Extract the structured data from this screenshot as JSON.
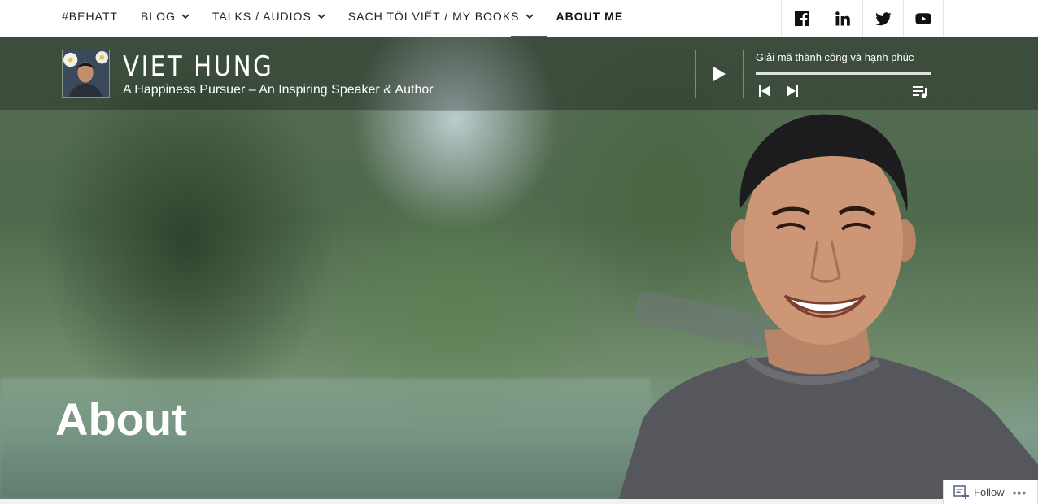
{
  "nav": {
    "items": [
      {
        "label": "#BEHATT",
        "dropdown": false
      },
      {
        "label": "BLOG",
        "dropdown": true
      },
      {
        "label": "TALKS / AUDIOS",
        "dropdown": true
      },
      {
        "label": "SÁCH TÔI VIẾT / MY BOOKS",
        "dropdown": true
      },
      {
        "label": "ABOUT ME",
        "dropdown": false,
        "active": true
      }
    ]
  },
  "social": [
    "facebook-icon",
    "linkedin-icon",
    "twitter-icon",
    "youtube-icon"
  ],
  "site": {
    "title": "VIET HUNG",
    "tagline": "A Happiness Pursuer – An Inspiring Speaker & Author"
  },
  "player": {
    "track_title": "Giải mã thành công và hạnh phúc"
  },
  "page": {
    "title": "About"
  },
  "follow": {
    "label": "Follow",
    "more": "•••"
  }
}
